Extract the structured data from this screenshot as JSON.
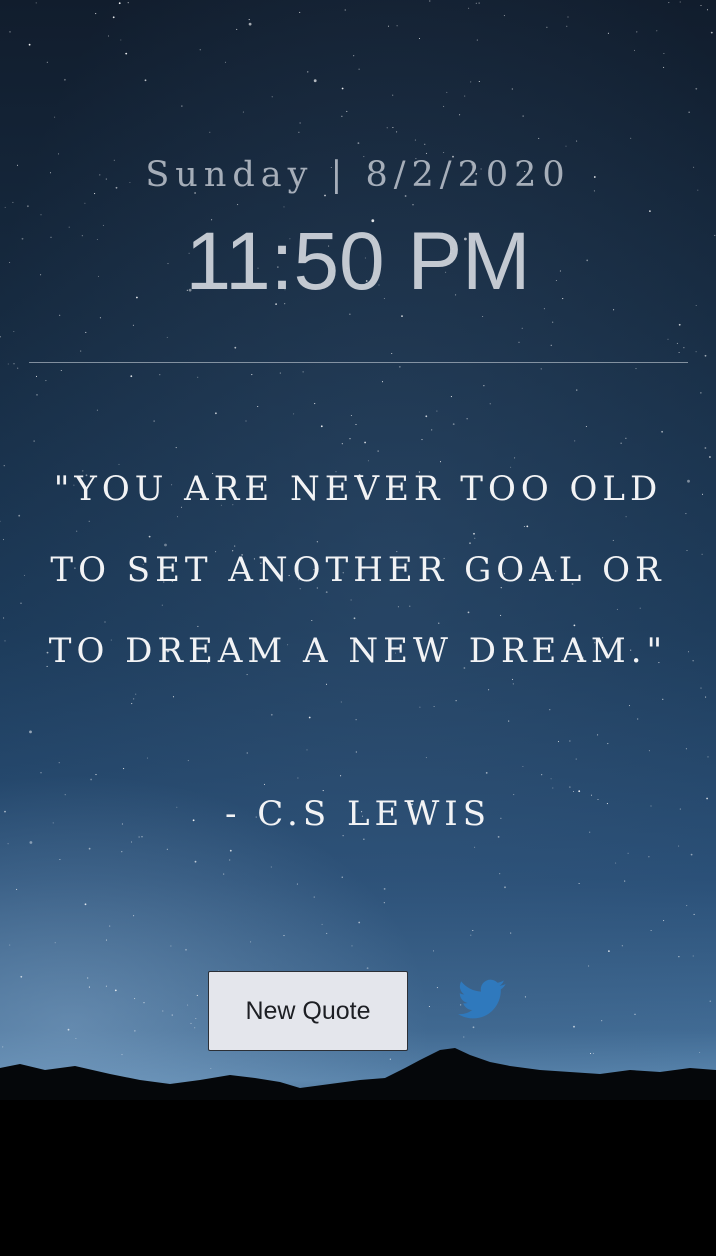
{
  "clock": {
    "date_line": "Sunday | 8/2/2020",
    "time": "11:50 PM"
  },
  "quote": {
    "text": "\"You are never too old to set another goal or to dream a new dream.\"",
    "author": "- C.S Lewis"
  },
  "actions": {
    "new_quote_label": "New Quote",
    "share_icon": "twitter-icon"
  },
  "colors": {
    "sky_top": "#111d2d",
    "sky_horizon": "#5a86ae",
    "mountains": "#05070a",
    "twitter_blue": "#2f79bd",
    "button_bg": "#e4e6ec"
  }
}
